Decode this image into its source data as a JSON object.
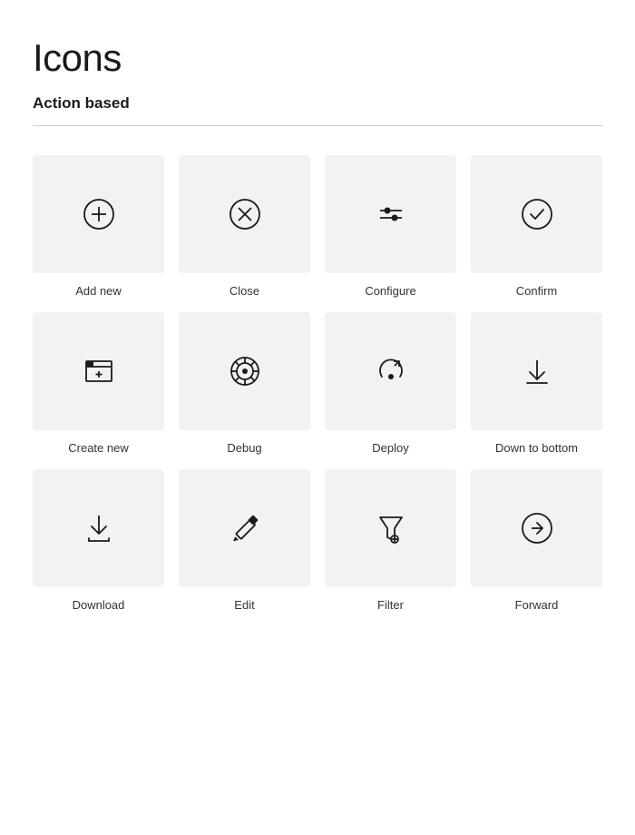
{
  "page": {
    "title": "Icons",
    "section": "Action based"
  },
  "icons": [
    {
      "name": "add-new-icon",
      "label": "Add new"
    },
    {
      "name": "close-icon",
      "label": "Close"
    },
    {
      "name": "configure-icon",
      "label": "Configure"
    },
    {
      "name": "confirm-icon",
      "label": "Confirm"
    },
    {
      "name": "create-new-icon",
      "label": "Create new"
    },
    {
      "name": "debug-icon",
      "label": "Debug"
    },
    {
      "name": "deploy-icon",
      "label": "Deploy"
    },
    {
      "name": "down-to-bottom-icon",
      "label": "Down to bottom"
    },
    {
      "name": "download-icon",
      "label": "Download"
    },
    {
      "name": "edit-icon",
      "label": "Edit"
    },
    {
      "name": "filter-icon",
      "label": "Filter"
    },
    {
      "name": "forward-icon",
      "label": "Forward"
    }
  ]
}
